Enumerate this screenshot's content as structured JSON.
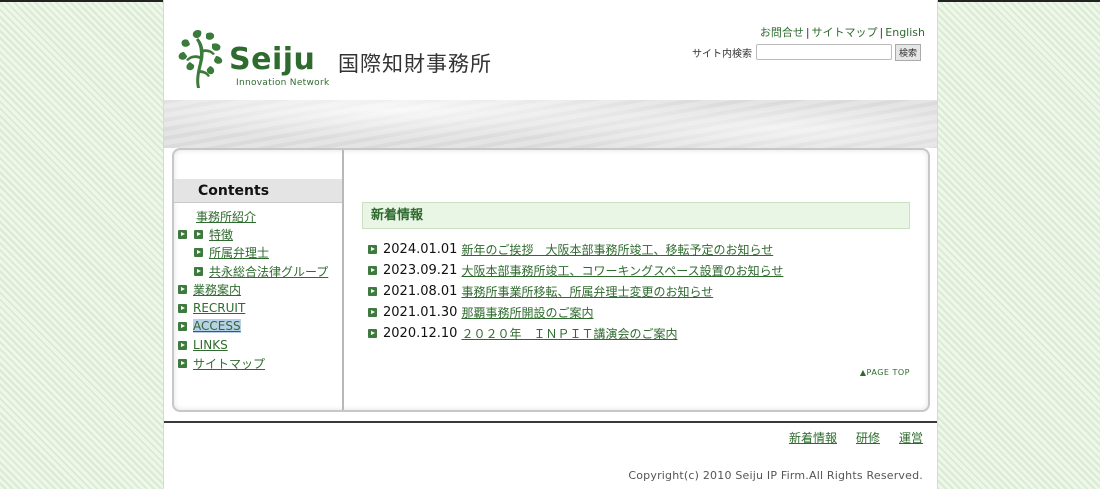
{
  "brand": {
    "name": "Seiju",
    "subtitle": "Innovation Network",
    "office_name": "国際知財事務所",
    "color": "#2f6b2f"
  },
  "header": {
    "util_links": [
      "お問合せ",
      "サイトマップ",
      "English"
    ],
    "search_label": "サイト内検索",
    "search_value": "",
    "search_button": "検索"
  },
  "sidebar": {
    "title": "Contents",
    "items": [
      {
        "label": "事務所紹介",
        "level": 0,
        "bullet": false
      },
      {
        "label": "特徴",
        "level": 1,
        "bullet": true
      },
      {
        "label": "所属弁理士",
        "level": 1,
        "bullet": true
      },
      {
        "label": "共永総合法律グループ",
        "level": 1,
        "bullet": true
      },
      {
        "label": "業務案内",
        "level": 0,
        "bullet": true
      },
      {
        "label": "RECRUIT",
        "level": 0,
        "bullet": true
      },
      {
        "label": "ACCESS",
        "level": 0,
        "bullet": true,
        "highlighted": true
      },
      {
        "label": "LINKS",
        "level": 0,
        "bullet": true
      },
      {
        "label": "サイトマップ",
        "level": 0,
        "bullet": true
      }
    ]
  },
  "news": {
    "title": "新着情報",
    "items": [
      {
        "date": "2024.01.01",
        "text": "新年のご挨拶　大阪本部事務所竣工、移転予定のお知らせ"
      },
      {
        "date": "2023.09.21",
        "text": "大阪本部事務所竣工、コワーキングスペース設置のお知らせ"
      },
      {
        "date": "2021.08.01",
        "text": "事務所事業所移転、所属弁理士変更のお知らせ"
      },
      {
        "date": "2021.01.30",
        "text": "那覇事務所開設のご案内"
      },
      {
        "date": "2020.12.10",
        "text": "２０２０年　ＩＮＰＩＴ講演会のご案内"
      }
    ],
    "page_top": "▲PAGE TOP"
  },
  "footer": {
    "links": [
      "新着情報",
      "研修",
      "運営"
    ],
    "copyright": "Copyright(c) 2010 Seiju IP Firm.All Rights Reserved."
  },
  "colors": {
    "accent_green": "#2f6b2f",
    "bullet_green": "#3d7a3d",
    "news_header_bg": "#e9f5e5",
    "access_highlight": "#b8d0e8"
  }
}
